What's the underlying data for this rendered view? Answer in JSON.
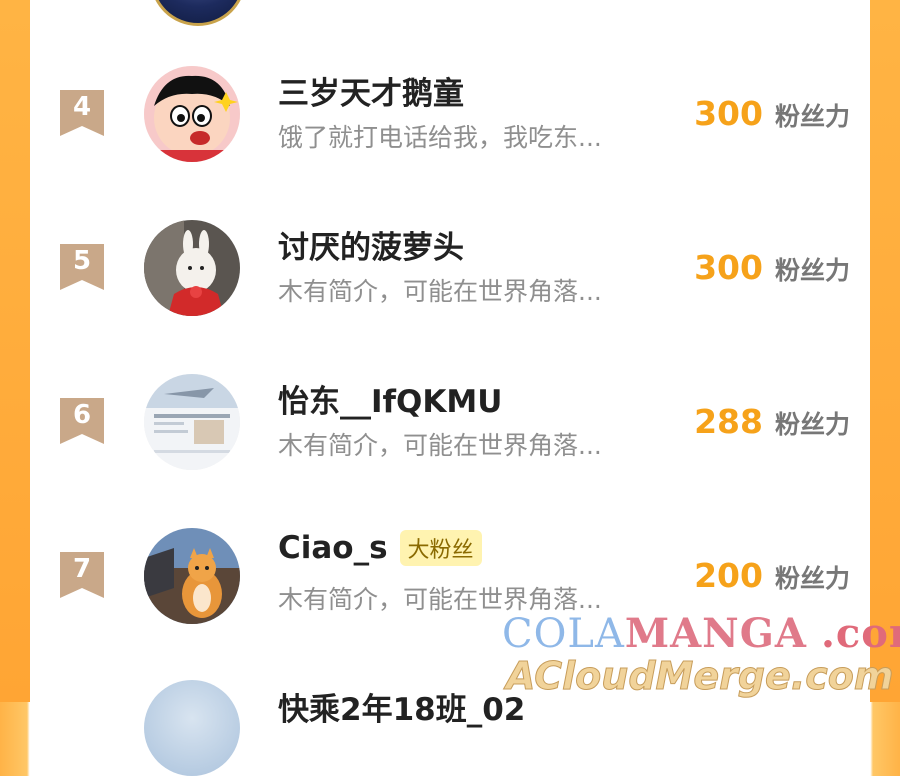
{
  "ranking": [
    {
      "rank": "4",
      "name": "三岁天才鹅童",
      "bio": "饿了就打电话给我，我吃东...",
      "score": "300",
      "unit": "粉丝力",
      "badge": null
    },
    {
      "rank": "5",
      "name": "讨厌的菠萝头",
      "bio": "木有简介，可能在世界角落...",
      "score": "300",
      "unit": "粉丝力",
      "badge": null
    },
    {
      "rank": "6",
      "name": "怡东__IfQKMU",
      "bio": "木有简介，可能在世界角落...",
      "score": "288",
      "unit": "粉丝力",
      "badge": null
    },
    {
      "rank": "7",
      "name": "Ciao_s",
      "bio": "木有简介，可能在世界角落...",
      "score": "200",
      "unit": "粉丝力",
      "badge": "大粉丝"
    }
  ],
  "partial_next": {
    "name": "快乘2年18班_02"
  },
  "watermark": {
    "line1_a": "COLA",
    "line1_b": "MANGA",
    "line1_c": ".com",
    "line2": "ACloudMerge.com"
  },
  "colors": {
    "accent": "#f6a21a",
    "side": "#ffa534"
  }
}
